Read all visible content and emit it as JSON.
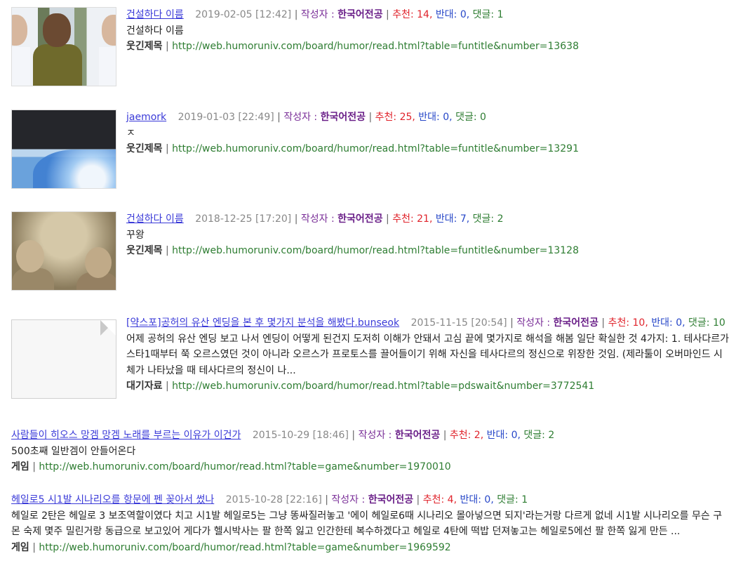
{
  "results": [
    {
      "title": "건설하다 이름",
      "date": "2019-02-05 [12:42]",
      "author_label": "작성자 :",
      "author": "한국어전공",
      "rec_label": "추천:",
      "rec": "14",
      "opp_label": "반대:",
      "opp": "0",
      "cmt_label": "댓글:",
      "cmt": "1",
      "desc": "건설하다 이름",
      "category": "웃긴제목",
      "url": "http://web.humoruniv.com/board/humor/read.html?table=funtitle&number=13638"
    },
    {
      "title": "jaemork",
      "date": "2019-01-03 [22:49]",
      "author_label": "작성자 :",
      "author": "한국어전공",
      "rec_label": "추천:",
      "rec": "25",
      "opp_label": "반대:",
      "opp": "0",
      "cmt_label": "댓글:",
      "cmt": "0",
      "desc": "ㅈ",
      "category": "웃긴제목",
      "url": "http://web.humoruniv.com/board/humor/read.html?table=funtitle&number=13291"
    },
    {
      "title": "건설하다 이름",
      "date": "2018-12-25 [17:20]",
      "author_label": "작성자 :",
      "author": "한국어전공",
      "rec_label": "추천:",
      "rec": "21",
      "opp_label": "반대:",
      "opp": "7",
      "cmt_label": "댓글:",
      "cmt": "2",
      "desc": "꾸왕",
      "category": "웃긴제목",
      "url": "http://web.humoruniv.com/board/humor/read.html?table=funtitle&number=13128"
    },
    {
      "title": "[약스포]공허의 유산 엔딩을 본 후 몇가지 분석을 해봤다.bunseok",
      "date": "2015-11-15 [20:54]",
      "author_label": "작성자 :",
      "author": "한국어전공",
      "rec_label": "추천:",
      "rec": "10",
      "opp_label": "반대:",
      "opp": "0",
      "cmt_label": "댓글:",
      "cmt": "10",
      "desc": "어제 공허의 유산 엔딩 보고 나서 엔딩이 어떻게 된건지 도저히 이해가 안돼서 고심 끝에 몇가지로 해석을 해봄 일단 확실한 것 4가지: 1. 테사다르가 스타1때부터 쭉 오르스였던 것이 아니라 오르스가 프로토스를 끌어들이기 위해 자신을 테사다르의 정신으로 위장한 것임. (제라툴이 오버마인드 시체가 나타났을 때 테사다르의 정신이 나...",
      "category": "대기자료",
      "url": "http://web.humoruniv.com/board/humor/read.html?table=pdswait&number=3772541"
    },
    {
      "title": "사람들이 히오스 망겜 망겜 노래를 부르는 이유가 이건가",
      "date": "2015-10-29 [18:46]",
      "author_label": "작성자 :",
      "author": "한국어전공",
      "rec_label": "추천:",
      "rec": "2",
      "opp_label": "반대:",
      "opp": "0",
      "cmt_label": "댓글:",
      "cmt": "2",
      "desc": "500초째 일반겜이 안들어온다",
      "category": "게임",
      "url": "http://web.humoruniv.com/board/humor/read.html?table=game&number=1970010"
    },
    {
      "title": "헤일로5 시1발 시나리오를 항문에 펜 꽂아서 썼나",
      "date": "2015-10-28 [22:16]",
      "author_label": "작성자 :",
      "author": "한국어전공",
      "rec_label": "추천:",
      "rec": "4",
      "opp_label": "반대:",
      "opp": "0",
      "cmt_label": "댓글:",
      "cmt": "1",
      "desc": "헤일로 2탄은 헤일로 3 보조역할이였다 치고 시1발 헤일로5는 그냥 똥싸질러놓고 '에이 헤일로6때 시나리오 몰아넣으면 되지'라는거랑 다르게 없네 시1발 시나리오를 무슨 구몬 숙제 몇주 밀린거랑 동급으로 보고있어 게다가 헬시박사는 팔 한쪽 잃고 인간한테 복수하겠다고 헤일로 4탄에 떡밥 던져놓고는 헤일로5에선 팔 한쪽 잃게 만든 ...",
      "category": "게임",
      "url": "http://web.humoruniv.com/board/humor/read.html?table=game&number=1969592"
    }
  ]
}
